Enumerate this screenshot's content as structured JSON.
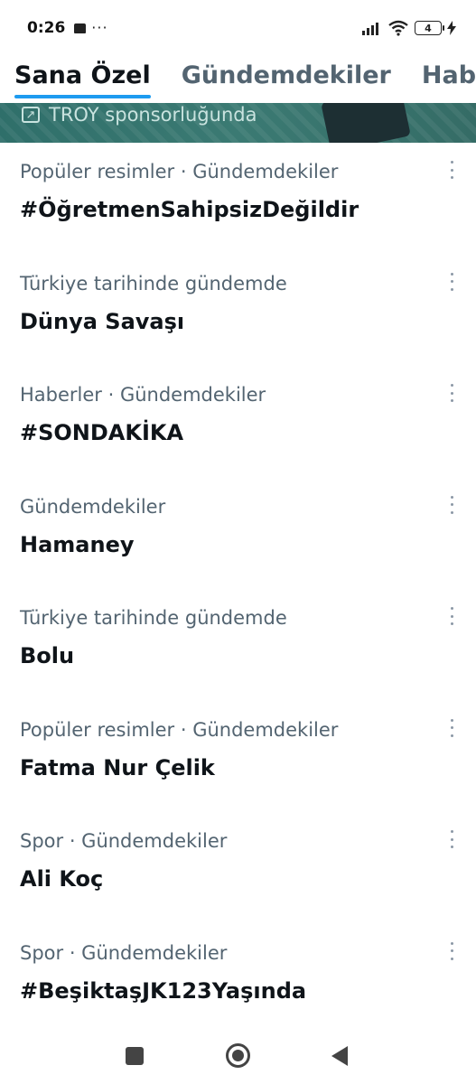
{
  "status_bar": {
    "time": "0:26",
    "battery": "4",
    "icons": [
      "sim-icon",
      "more-icon",
      "signal-icon",
      "wifi-icon",
      "battery-icon",
      "charging-icon"
    ]
  },
  "tabs": [
    {
      "label": "Sana Özel",
      "active": true
    },
    {
      "label": "Gündemdekiler",
      "active": false
    },
    {
      "label": "Haber",
      "active": false
    }
  ],
  "promo": {
    "label": "TROY sponsorluğunda",
    "icon": "external-link-icon"
  },
  "trends": [
    {
      "meta": "Popüler resimler · Gündemdekiler",
      "title": "#ÖğretmenSahipsizDeğildir"
    },
    {
      "meta": "Türkiye tarihinde gündemde",
      "title": "Dünya Savaşı"
    },
    {
      "meta": "Haberler · Gündemdekiler",
      "title": "#SONDAKİKA"
    },
    {
      "meta": "Gündemdekiler",
      "title": "Hamaney"
    },
    {
      "meta": "Türkiye tarihinde gündemde",
      "title": "Bolu"
    },
    {
      "meta": "Popüler resimler · Gündemdekiler",
      "title": "Fatma Nur Çelik"
    },
    {
      "meta": "Spor · Gündemdekiler",
      "title": "Ali Koç"
    },
    {
      "meta": "Spor · Gündemdekiler",
      "title": "#BeşiktaşJK123Yaşında"
    }
  ],
  "colors": {
    "accent": "#1d9bf0",
    "secondary_text": "#536471",
    "banner": "#356c66"
  }
}
